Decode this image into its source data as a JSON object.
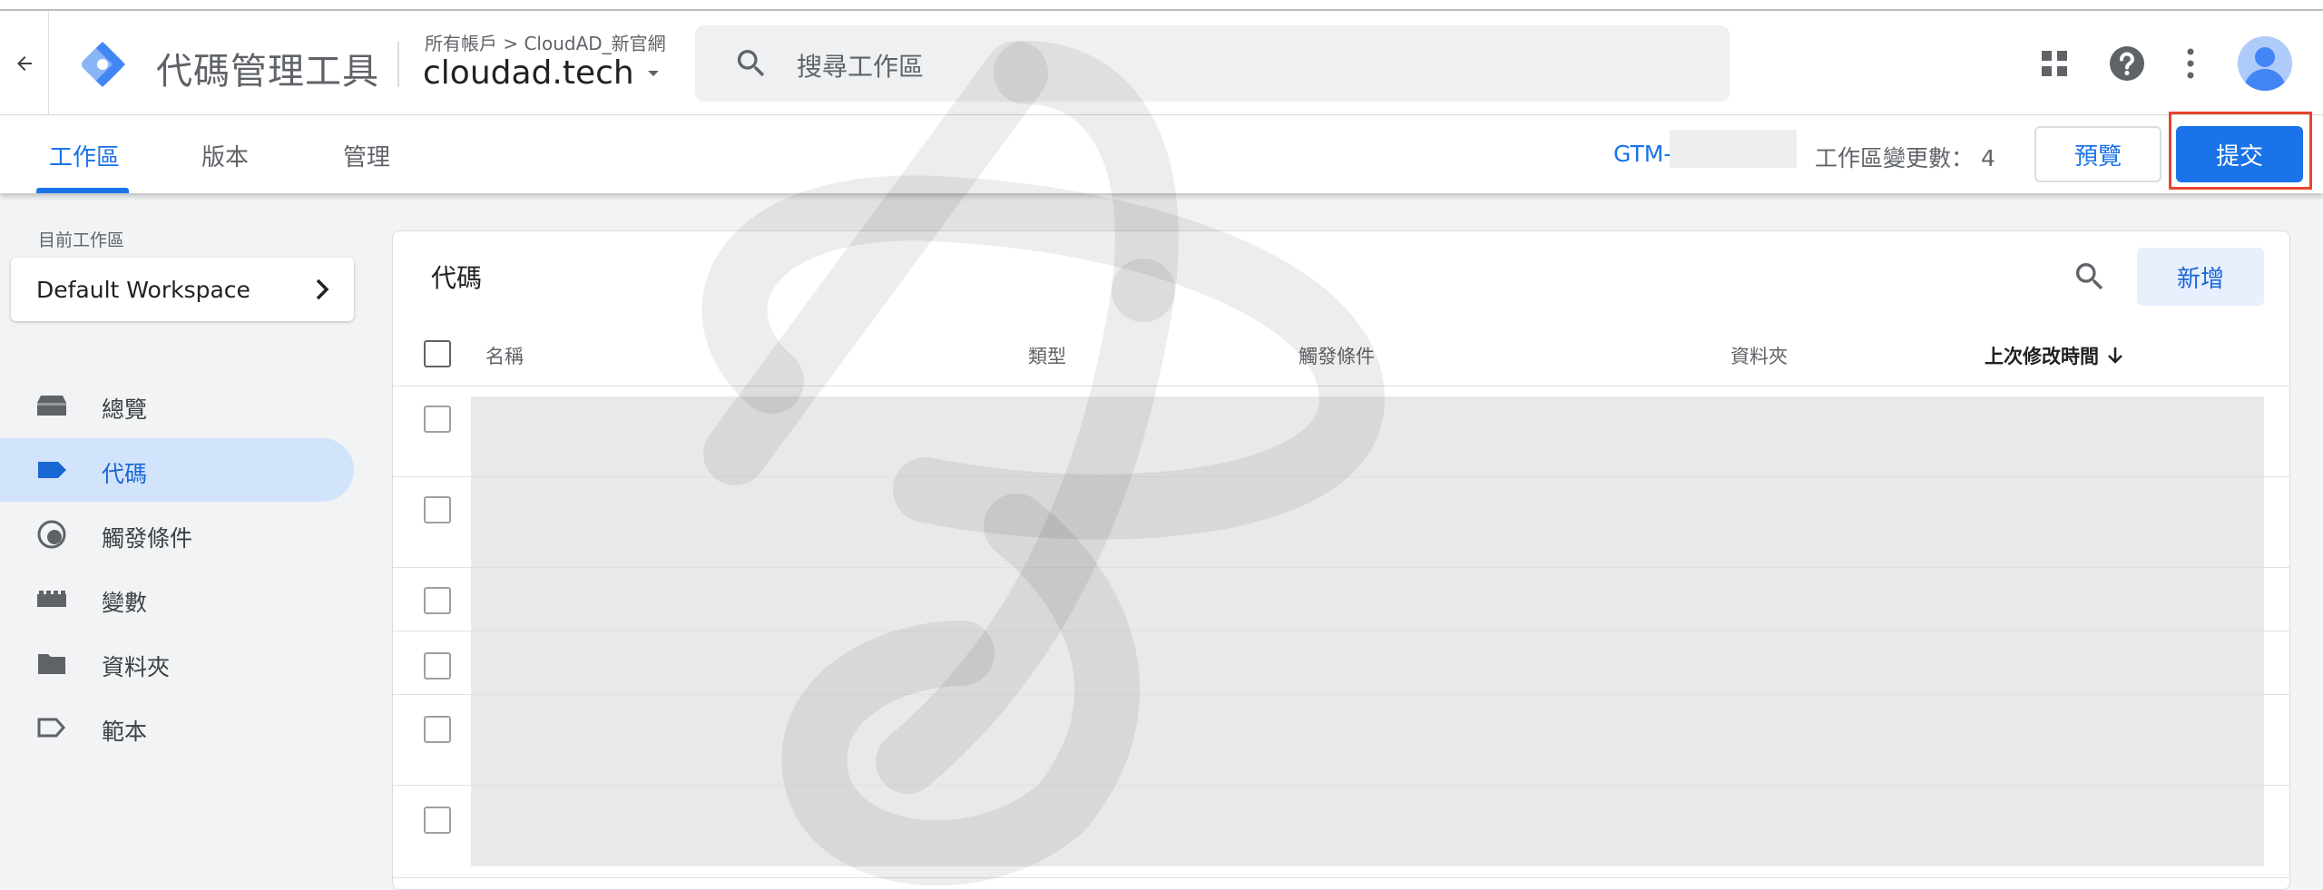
{
  "header": {
    "product_name": "代碼管理工具",
    "breadcrumb": "所有帳戶 > CloudAD_新官網",
    "container": "cloudad.tech",
    "search_placeholder": "搜尋工作區"
  },
  "tabs": [
    {
      "label": "工作區",
      "active": true
    },
    {
      "label": "版本",
      "active": false
    },
    {
      "label": "管理",
      "active": false
    }
  ],
  "toolbar": {
    "gtm_id": "GTM-",
    "changes_label": "工作區變更數： 4",
    "preview_label": "預覽",
    "submit_label": "提交"
  },
  "sidebar": {
    "workspace_label": "目前工作區",
    "workspace_name": "Default Workspace",
    "items": [
      {
        "label": "總覽",
        "icon": "overview-icon"
      },
      {
        "label": "代碼",
        "icon": "tag-icon",
        "active": true
      },
      {
        "label": "觸發條件",
        "icon": "trigger-icon"
      },
      {
        "label": "變數",
        "icon": "variable-icon"
      },
      {
        "label": "資料夾",
        "icon": "folder-icon"
      },
      {
        "label": "範本",
        "icon": "template-icon"
      }
    ]
  },
  "main": {
    "title": "代碼",
    "new_label": "新增",
    "columns": [
      "名稱",
      "類型",
      "觸發條件",
      "資料夾",
      "上次修改時間"
    ]
  },
  "colors": {
    "accent": "#1a73e8",
    "active_nav_bg": "#d2e3fc",
    "highlight_frame": "#e8442e"
  }
}
